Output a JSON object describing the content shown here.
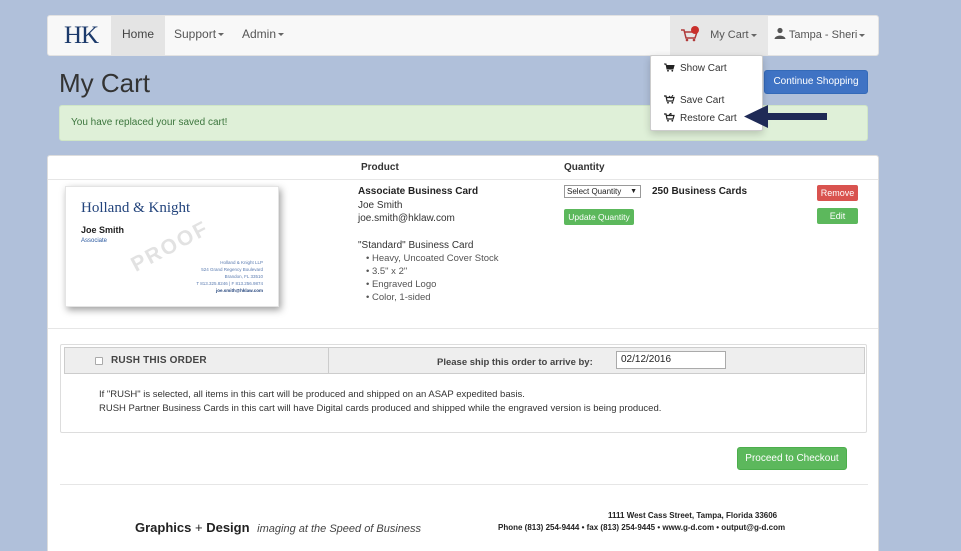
{
  "nav": {
    "brand": "HK",
    "home": "Home",
    "support": "Support",
    "admin": "Admin",
    "cart": "My Cart",
    "user": "Tampa - Sheri"
  },
  "page": {
    "title": "My Cart",
    "continue_label": "Continue Shopping",
    "alert": "You have replaced your saved cart!"
  },
  "cart_menu": {
    "items": [
      "Show Cart",
      "Save Cart",
      "Restore Cart"
    ]
  },
  "table": {
    "col_product": "Product",
    "col_quantity": "Quantity"
  },
  "item": {
    "name": "Associate Business Card",
    "person": "Joe Smith",
    "email": "joe.smith@hklaw.com",
    "style": "\"Standard\" Business Card",
    "features": [
      "Heavy, Uncoated Cover Stock",
      "3.5\" x 2\"",
      "Engraved Logo",
      "Color, 1-sided"
    ],
    "qty_select": "Select Quantity",
    "qty_current": "250 Business Cards",
    "update_label": "Update Quantity",
    "remove_label": "Remove",
    "edit_label": "Edit"
  },
  "proof": {
    "firm": "Holland & Knight",
    "name": "Joe Smith",
    "title": "Associate",
    "addr1": "Holland & Knight LLP",
    "addr2": "524 Grand Regency Boulevard",
    "addr3": "Brandon, FL 33510",
    "phone": "T 813.325.8246 | F 813.256.9874",
    "email": "joe.smith@hklaw.com",
    "watermark": "PROOF"
  },
  "rush": {
    "label": "RUSH THIS ORDER",
    "checked": false,
    "ship_label": "Please ship this order to arrive by:",
    "date": "02/12/2016",
    "note1": "If \"RUSH\" is selected, all items in this cart will be produced and shipped on an ASAP expedited basis.",
    "note2": "RUSH Partner Business Cards in this cart will have Digital cards produced and shipped while the engraved version is being produced."
  },
  "checkout_label": "Proceed to Checkout",
  "footer": {
    "company_a": "Graphics",
    "plus": "+",
    "company_b": "Design",
    "tagline": "imaging at the Speed of Business",
    "address": "1111 West Cass Street, Tampa, Florida 33606",
    "contact": "Phone (813) 254-9444 • fax (813) 254-9445 • www.g-d.com • output@g-d.com"
  },
  "colors": {
    "page_bg": "#b0c0da",
    "primary": "#3f73c4",
    "success": "#5cb85c",
    "danger": "#d9534f",
    "brand": "#1c3a6b"
  }
}
